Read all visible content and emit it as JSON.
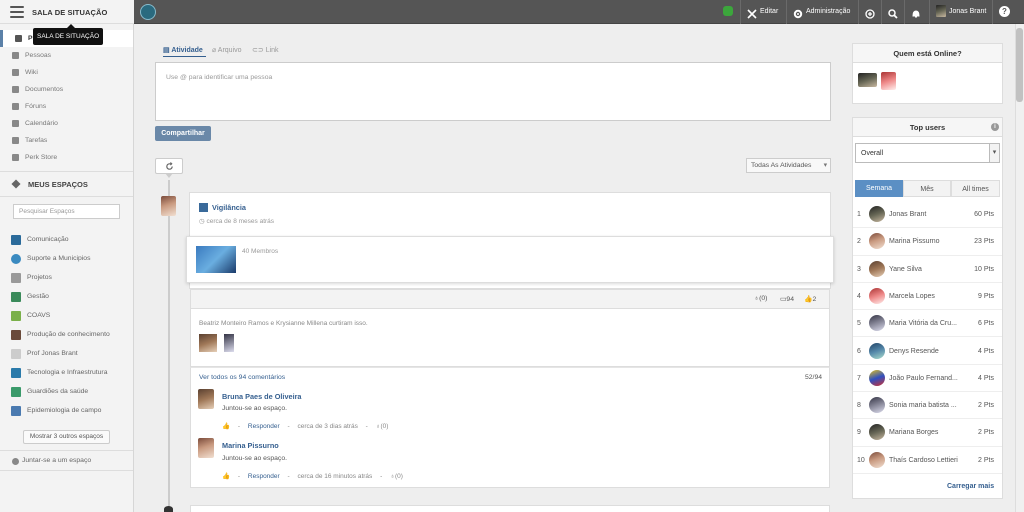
{
  "sidebar": {
    "title": "SALA DE SITUAÇÃO",
    "tooltip": "SALA DE SITUAÇÃO",
    "nav": [
      {
        "label": "P",
        "icon": "home-icon"
      },
      {
        "label": "Pessoas",
        "icon": "people-icon"
      },
      {
        "label": "Wiki",
        "icon": "wiki-icon"
      },
      {
        "label": "Documentos",
        "icon": "folder-icon"
      },
      {
        "label": "Fóruns",
        "icon": "forum-icon"
      },
      {
        "label": "Calendário",
        "icon": "calendar-icon"
      },
      {
        "label": "Tarefas",
        "icon": "tasks-icon"
      },
      {
        "label": "Perk Store",
        "icon": "store-icon"
      }
    ],
    "my_spaces_title": "MEUS ESPAÇOS",
    "search_placeholder": "Pesquisar Espaços",
    "spaces": [
      {
        "label": "Comunicação",
        "color": "#2a6a9a"
      },
      {
        "label": "Suporte a Municipios",
        "color": "#3a8ac0"
      },
      {
        "label": "Projetos",
        "color": "#999999"
      },
      {
        "label": "Gestão",
        "color": "#3a8a5a"
      },
      {
        "label": "COAVS",
        "color": "#7ab04a"
      },
      {
        "label": "Produção de conhecimento",
        "color": "#6a4a3a"
      },
      {
        "label": "Prof Jonas Brant",
        "color": "#cccccc"
      },
      {
        "label": "Tecnologia e Infraestrutura",
        "color": "#2a7aaa"
      },
      {
        "label": "Guardiões da saúde",
        "color": "#3a9a6a"
      },
      {
        "label": "Epidemiologia de campo",
        "color": "#4a7ab0"
      }
    ],
    "more_spaces": "Mostrar 3 outros espaços",
    "join_space": "Juntar-se a um espaço"
  },
  "topbar": {
    "edit": "Editar",
    "admin": "Administração",
    "user": "Jonas Brant",
    "help": "?"
  },
  "composer": {
    "tabs": [
      "Atividade",
      "Arquivo",
      "Link"
    ],
    "placeholder": "Use @ para identificar uma pessoa",
    "share": "Compartilhar",
    "filter": "Todas As Atividades"
  },
  "activity": {
    "space_name": "Vigilância",
    "time": "cerca de 8 meses atrás",
    "members": "40 Membros",
    "stats": {
      "kudos": "(0)",
      "comments": "94",
      "likes": "2"
    },
    "liked_by": "Beatriz Monteiro Ramos e Krysianne Millena curtiram isso.",
    "view_all": "Ver todos os 94 comentários",
    "count": "52/94",
    "comments": [
      {
        "author": "Bruna Paes de Oliveira",
        "text": "Juntou-se ao espaço.",
        "reply": "Responder",
        "time": "cerca de 3 dias atrás",
        "kudos": "(0)"
      },
      {
        "author": "Marina Pissurno",
        "text": "Juntou-se ao espaço.",
        "reply": "Responder",
        "time": "cerca de 16 minutos atrás",
        "kudos": "(0)"
      }
    ]
  },
  "online": {
    "title": "Quem está Online?"
  },
  "top_users": {
    "title": "Top users",
    "select": "Overall",
    "tabs": [
      "Semana",
      "Mês",
      "All times"
    ],
    "rows": [
      {
        "rank": "1",
        "name": "Jonas Brant",
        "pts": "60 Pts"
      },
      {
        "rank": "2",
        "name": "Marina Pissurno",
        "pts": "23 Pts"
      },
      {
        "rank": "3",
        "name": "Yane Silva",
        "pts": "10 Pts"
      },
      {
        "rank": "4",
        "name": "Marcela Lopes",
        "pts": "9 Pts"
      },
      {
        "rank": "5",
        "name": "Maria Vitória da Cru...",
        "pts": "6 Pts"
      },
      {
        "rank": "6",
        "name": "Denys Resende",
        "pts": "4 Pts"
      },
      {
        "rank": "7",
        "name": "João Paulo Fernand...",
        "pts": "4 Pts"
      },
      {
        "rank": "8",
        "name": "Sonia maria batista ...",
        "pts": "2 Pts"
      },
      {
        "rank": "9",
        "name": "Mariana Borges",
        "pts": "2 Pts"
      },
      {
        "rank": "10",
        "name": "Thaís Cardoso Lettieri",
        "pts": "2 Pts"
      }
    ],
    "load_more": "Carregar mais"
  }
}
